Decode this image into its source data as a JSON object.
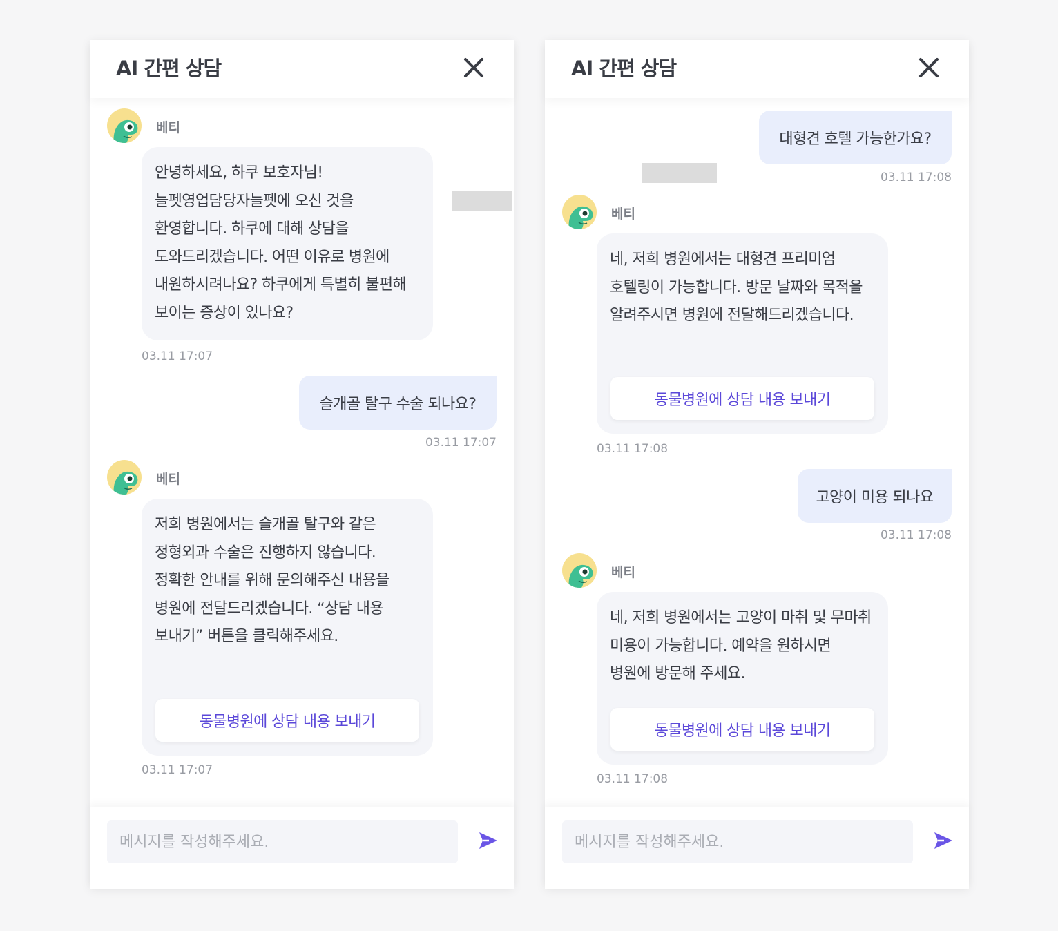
{
  "left": {
    "title": "AI 간편 상담",
    "messages": [
      {
        "sender": "베티",
        "text": "안녕하세요, 하쿠 보호자님! 늘펫영업담당자늘펫에 오신 것을 환영합니다. 하쿠에 대해 상담을 도와드리겠습니다. 어떤 이유로 병원에 내원하시려나요? 하쿠에게 특별히 불편해 보이는 증상이 있나요?",
        "time": "03.11 17:07"
      },
      {
        "text": "슬개골 탈구 수술 되나요?",
        "time": "03.11 17:07"
      },
      {
        "sender": "베티",
        "text": "저희 병원에서는 슬개골 탈구와 같은 정형외과 수술은 진행하지 않습니다. 정확한 안내를 위해 문의해주신 내용을 병원에 전달드리겠습니다. “상담 내용 보내기” 버튼을 클릭해주세요.",
        "button": "동물병원에 상담 내용 보내기",
        "time": "03.11 17:07"
      }
    ],
    "input_placeholder": "메시지를 작성해주세요."
  },
  "right": {
    "title": "AI 간편 상담",
    "messages": [
      {
        "text": "대형견 호텔 가능한가요?",
        "time": "03.11 17:08"
      },
      {
        "sender": "베티",
        "text": "네, 저희 병원에서는 대형견 프리미엄 호텔링이 가능합니다. 방문 날짜와 목적을 알려주시면 병원에 전달해드리겠습니다.",
        "button": "동물병원에 상담 내용 보내기",
        "time": "03.11 17:08"
      },
      {
        "text": "고양이 미용 되나요",
        "time": "03.11 17:08"
      },
      {
        "sender": "베티",
        "text": "네, 저희 병원에서는 고양이 마취 및 무마취 미용이 가능합니다. 예약을 원하시면 병원에 방문해 주세요.",
        "button": "동물병원에 상담 내용 보내기",
        "time": "03.11 17:08"
      }
    ],
    "input_placeholder": "메시지를 작성해주세요."
  },
  "colors": {
    "accent": "#5b48d9",
    "user_bubble": "#e9eefc",
    "bot_bubble": "#f4f5f9",
    "avatar_bg": "#f7e08f",
    "mascot": "#3fbf93"
  },
  "icons": {
    "close": "close-icon",
    "send": "send-icon",
    "avatar": "chameleon-mascot-icon"
  }
}
